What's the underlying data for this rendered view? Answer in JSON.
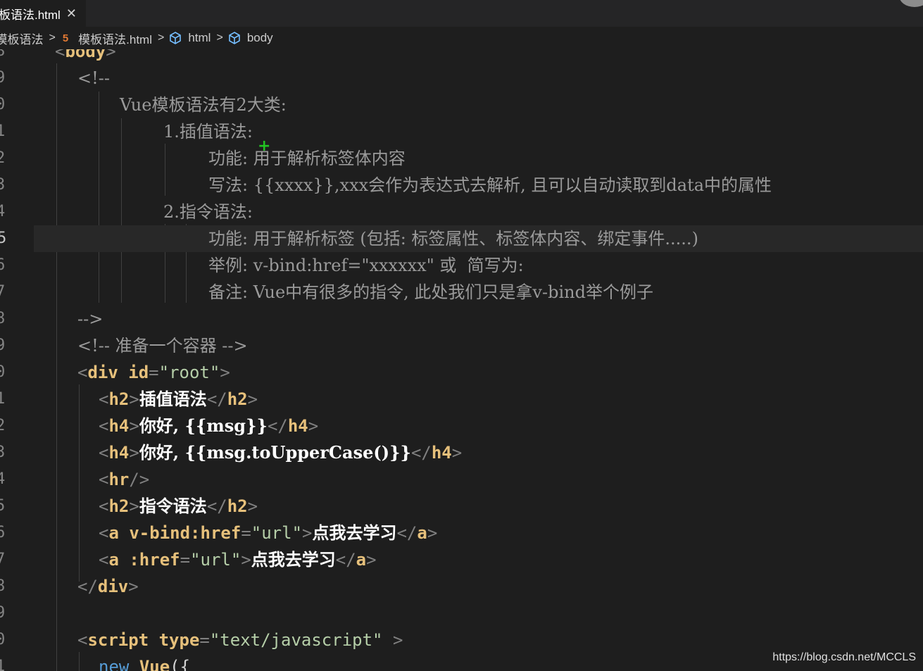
{
  "tab": {
    "label": "板语法.html",
    "close": "✕"
  },
  "breadcrumb": {
    "items": [
      "e模板语法",
      "模板语法.html",
      "html",
      "body"
    ],
    "separator": ">",
    "file_icon": "html5-file-icon",
    "symbol_icon": "cube-symbol-icon"
  },
  "lines": [
    {
      "n": "8",
      "code": "<body>"
    },
    {
      "n": "9",
      "code": "<!--"
    },
    {
      "n": "0",
      "code": "Vue模板语法有2大类:"
    },
    {
      "n": "1",
      "code": "1.插值语法:"
    },
    {
      "n": "2",
      "code": "功能: 用于解析标签体内容"
    },
    {
      "n": "3",
      "code": "写法: {{xxxx}},xxx会作为表达式去解析, 且可以自动读取到data中的属性"
    },
    {
      "n": "4",
      "code": "2.指令语法:"
    },
    {
      "n": "5",
      "code": "功能: 用于解析标签 (包括: 标签属性、标签体内容、绑定事件.....)"
    },
    {
      "n": "6",
      "code": "举例: v-bind:href=\"xxxxxx\" 或  简写为:"
    },
    {
      "n": "7",
      "code": "备注: Vue中有很多的指令, 此处我们只是拿v-bind举个例子"
    },
    {
      "n": "8",
      "code": "-->"
    },
    {
      "n": "9",
      "code": "<!-- 准备一个容器 -->"
    },
    {
      "n": "0",
      "code": "<div id=\"root\">"
    },
    {
      "n": "1",
      "code": "<h2>插值语法</h2>"
    },
    {
      "n": "2",
      "code": "<h4>你好, {{msg}}</h4>"
    },
    {
      "n": "3",
      "code": "<h4>你好, {{msg.toUpperCase()}}</h4>"
    },
    {
      "n": "4",
      "code": "<hr/>"
    },
    {
      "n": "5",
      "code": "<h2>指令语法</h2>"
    },
    {
      "n": "6",
      "code": "<a v-bind:href=\"url\">点我去学习</a>"
    },
    {
      "n": "7",
      "code": "<a :href=\"url\">点我去学习</a>"
    },
    {
      "n": "8",
      "code": "</div>"
    },
    {
      "n": "9",
      "code": ""
    },
    {
      "n": "0",
      "code": "<script type=\"text/javascript\" >"
    },
    {
      "n": "1",
      "code": "new Vue({"
    }
  ],
  "watermark": "https://blog.csdn.net/MCCLS",
  "colors": {
    "background": "#1e1e1e",
    "tag": "#e6c07b",
    "string": "#b5cea8",
    "comment": "#9a9a9a",
    "keyword": "#569cd6"
  }
}
